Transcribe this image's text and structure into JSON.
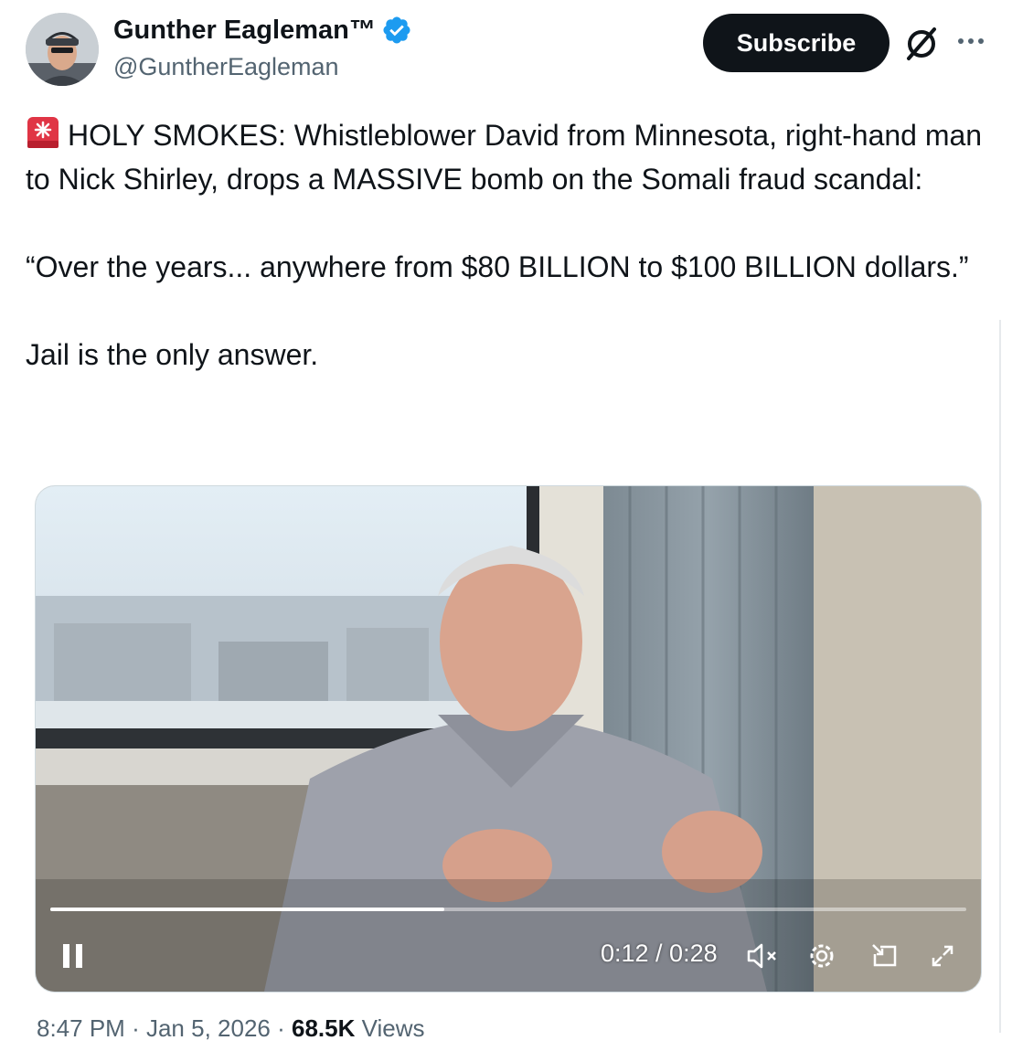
{
  "author": {
    "name": "Gunther Eagleman™",
    "handle": "@GuntherEagleman",
    "verified_color": "#1d9bf0"
  },
  "actions": {
    "subscribe_label": "Subscribe",
    "grok_icon": "grok-icon",
    "more_icon": "more-icon"
  },
  "tweet": {
    "emoji": "siren-icon",
    "text": "HOLY SMOKES: Whistleblower David from Minnesota, right-hand man to Nick Shirley, drops a MASSIVE bomb on the Somali fraud scandal:\n\n“Over the years... anywhere from $80 BILLION to $100 BILLION dollars.”\n\nJail is the only answer."
  },
  "video": {
    "time_label": "0:12 / 0:28",
    "progress": 0.43,
    "controls": [
      "pause-icon",
      "mute-icon",
      "settings-icon",
      "pip-icon",
      "fullscreen-icon"
    ]
  },
  "meta": {
    "time": "8:47 PM",
    "date": "Jan 5, 2026",
    "views_count": "68.5K",
    "views_label": "Views",
    "separator": "·"
  },
  "colors": {
    "text": "#0f1419",
    "secondary": "#536471",
    "button_bg": "#0f1419"
  }
}
